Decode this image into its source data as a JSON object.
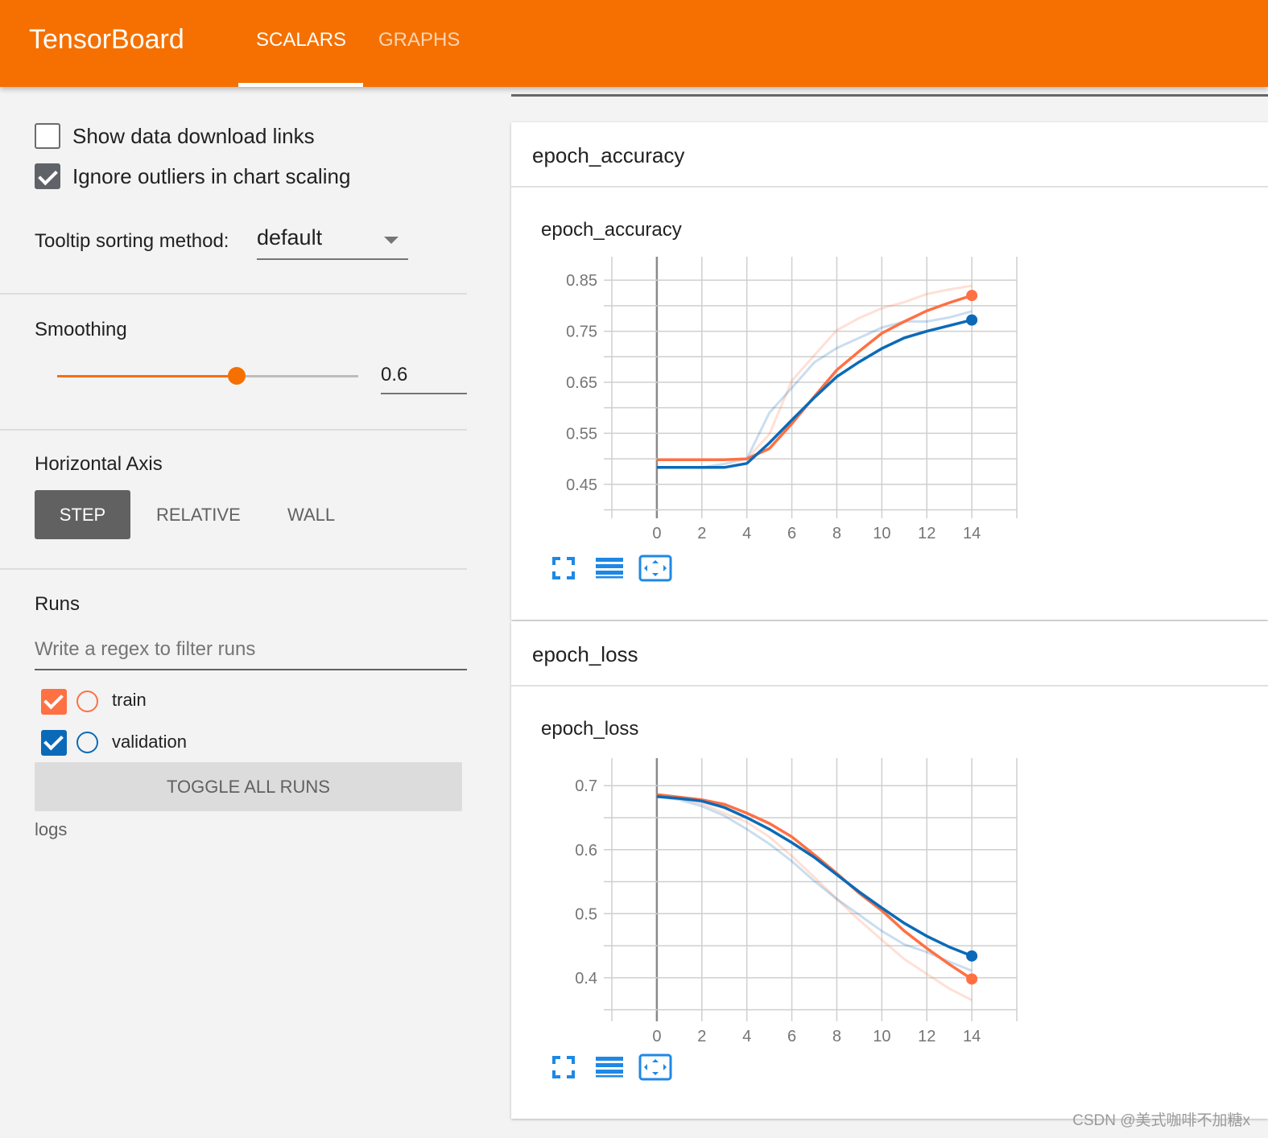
{
  "header": {
    "title": "TensorBoard",
    "tabs": [
      {
        "label": "SCALARS",
        "active": true
      },
      {
        "label": "GRAPHS",
        "active": false
      }
    ],
    "color": "#f57000"
  },
  "sidebar": {
    "show_download_links": {
      "label": "Show data download links",
      "checked": false
    },
    "ignore_outliers": {
      "label": "Ignore outliers in chart scaling",
      "checked": true
    },
    "tooltip_sorting": {
      "label": "Tooltip sorting method:",
      "value": "default"
    },
    "smoothing": {
      "label": "Smoothing",
      "value": "0.6",
      "fraction": 0.6
    },
    "horizontal_axis": {
      "label": "Horizontal Axis",
      "options": [
        "STEP",
        "RELATIVE",
        "WALL"
      ],
      "selected": "STEP"
    },
    "runs": {
      "label": "Runs",
      "filter_placeholder": "Write a regex to filter runs",
      "items": [
        {
          "name": "train",
          "checked": true,
          "color": "#ff7043"
        },
        {
          "name": "validation",
          "checked": true,
          "color": "#0b6ab8"
        }
      ],
      "toggle_label": "TOGGLE ALL RUNS",
      "log_dir": "logs"
    }
  },
  "cards": [
    {
      "header": "epoch_accuracy",
      "chart_title": "epoch_accuracy"
    },
    {
      "header": "epoch_loss",
      "chart_title": "epoch_loss"
    }
  ],
  "chart_data": [
    {
      "type": "line",
      "title": "epoch_accuracy",
      "xlim": [
        -2,
        16
      ],
      "ylim": [
        0.396,
        0.896
      ],
      "x_ticks": [
        0,
        2,
        4,
        6,
        8,
        10,
        12,
        14
      ],
      "y_ticks": [
        "0.45",
        "0.55",
        "0.65",
        "0.75",
        "0.85"
      ],
      "grid": true,
      "x": [
        0,
        1,
        2,
        3,
        4,
        5,
        6,
        7,
        8,
        9,
        10,
        11,
        12,
        13,
        14
      ],
      "series": [
        {
          "name": "train",
          "color": "#ff7043",
          "smoothed": [
            0.498,
            0.498,
            0.498,
            0.498,
            0.5,
            0.52,
            0.569,
            0.622,
            0.674,
            0.711,
            0.746,
            0.769,
            0.79,
            0.806,
            0.82
          ],
          "raw": [
            0.498,
            0.498,
            0.498,
            0.498,
            0.5,
            0.548,
            0.653,
            0.703,
            0.752,
            0.776,
            0.795,
            0.807,
            0.823,
            0.832,
            0.839
          ]
        },
        {
          "name": "validation",
          "color": "#0b6ab8",
          "smoothed": [
            0.483,
            0.483,
            0.483,
            0.483,
            0.491,
            0.531,
            0.576,
            0.62,
            0.661,
            0.69,
            0.716,
            0.737,
            0.75,
            0.761,
            0.772
          ],
          "raw": [
            0.483,
            0.483,
            0.483,
            0.49,
            0.5,
            0.59,
            0.639,
            0.689,
            0.717,
            0.737,
            0.757,
            0.769,
            0.769,
            0.777,
            0.789
          ]
        }
      ]
    },
    {
      "type": "line",
      "title": "epoch_loss",
      "xlim": [
        -2,
        16
      ],
      "ylim": [
        0.342,
        0.743
      ],
      "x_ticks": [
        0,
        2,
        4,
        6,
        8,
        10,
        12,
        14
      ],
      "y_ticks": [
        "0.4",
        "0.5",
        "0.6",
        "0.7"
      ],
      "grid": true,
      "x": [
        0,
        1,
        2,
        3,
        4,
        5,
        6,
        7,
        8,
        9,
        10,
        11,
        12,
        13,
        14
      ],
      "series": [
        {
          "name": "train",
          "color": "#ff7043",
          "smoothed": [
            0.686,
            0.682,
            0.678,
            0.671,
            0.657,
            0.641,
            0.62,
            0.592,
            0.563,
            0.532,
            0.505,
            0.473,
            0.446,
            0.421,
            0.398
          ],
          "raw": [
            0.686,
            0.68,
            0.672,
            0.657,
            0.643,
            0.62,
            0.59,
            0.557,
            0.523,
            0.49,
            0.459,
            0.429,
            0.406,
            0.383,
            0.365
          ]
        },
        {
          "name": "validation",
          "color": "#0b6ab8",
          "smoothed": [
            0.683,
            0.68,
            0.676,
            0.666,
            0.65,
            0.632,
            0.611,
            0.588,
            0.561,
            0.534,
            0.509,
            0.485,
            0.465,
            0.448,
            0.434
          ],
          "raw": [
            0.683,
            0.678,
            0.668,
            0.653,
            0.632,
            0.609,
            0.582,
            0.551,
            0.523,
            0.498,
            0.473,
            0.452,
            0.44,
            0.425,
            0.411
          ]
        }
      ]
    }
  ],
  "chart_icons": [
    "fullscreen-icon",
    "toggle-log-scale-icon",
    "fit-domain-icon"
  ],
  "watermark": "CSDN @美式咖啡不加糖x"
}
